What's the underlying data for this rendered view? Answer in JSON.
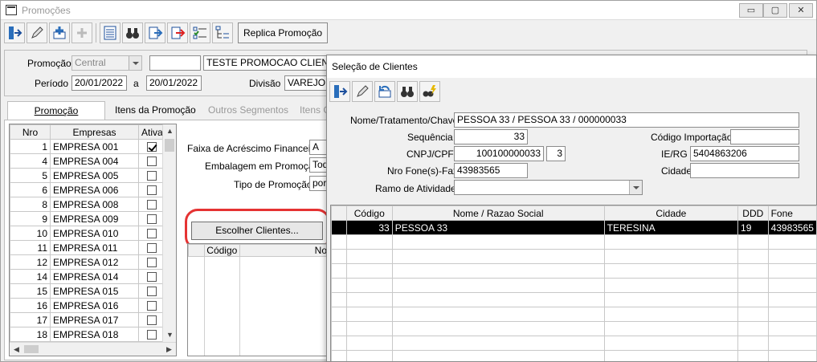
{
  "main_window": {
    "title": "Promoções",
    "controls": {
      "minimize": "▭",
      "restore": "▢",
      "close": "✕"
    },
    "toolbar": {
      "icons": [
        "exit-icon",
        "edit-pencil-icon",
        "add-record-icon",
        "plus-disabled-icon",
        "grid-list-icon",
        "binoculars-search-icon",
        "import-arrow-icon",
        "export-red-arrow-icon",
        "checklist-icon",
        "tree-list-icon"
      ],
      "replica_label": "Replica Promoção"
    },
    "form": {
      "promocao_label": "Promoção",
      "promocao_combo": "Central",
      "promocao_code": "",
      "promocao_desc": "TESTE PROMOCAO CLIENTE",
      "periodo_label": "Período",
      "periodo_inicio": "20/01/2022",
      "periodo_a": "a",
      "periodo_fim": "20/01/2022",
      "divisao_label": "Divisão",
      "divisao_value": "VAREJO"
    },
    "tabs": [
      {
        "label": "Promoção"
      },
      {
        "label": "Itens da Promoção"
      },
      {
        "label": "Outros Segmentos"
      },
      {
        "label": "Itens G"
      }
    ],
    "empresas_grid": {
      "headers": [
        "Nro",
        "Empresas",
        "Ativa"
      ],
      "rows": [
        {
          "nro": "1",
          "empresa": "EMPRESA 001",
          "ativa": true
        },
        {
          "nro": "4",
          "empresa": "EMPRESA 004",
          "ativa": false
        },
        {
          "nro": "5",
          "empresa": "EMPRESA 005",
          "ativa": false
        },
        {
          "nro": "6",
          "empresa": "EMPRESA 006",
          "ativa": false
        },
        {
          "nro": "8",
          "empresa": "EMPRESA 008",
          "ativa": false
        },
        {
          "nro": "9",
          "empresa": "EMPRESA 009",
          "ativa": false
        },
        {
          "nro": "10",
          "empresa": "EMPRESA 010",
          "ativa": false
        },
        {
          "nro": "11",
          "empresa": "EMPRESA 011",
          "ativa": false
        },
        {
          "nro": "12",
          "empresa": "EMPRESA 012",
          "ativa": false
        },
        {
          "nro": "14",
          "empresa": "EMPRESA 014",
          "ativa": false
        },
        {
          "nro": "15",
          "empresa": "EMPRESA 015",
          "ativa": false
        },
        {
          "nro": "16",
          "empresa": "EMPRESA 016",
          "ativa": false
        },
        {
          "nro": "17",
          "empresa": "EMPRESA 017",
          "ativa": false
        },
        {
          "nro": "18",
          "empresa": "EMPRESA 018",
          "ativa": false
        }
      ]
    },
    "fields": {
      "faixa_label": "Faixa de Acréscimo Financeiro",
      "faixa_value": "A",
      "embalagem_label": "Embalagem em Promoção",
      "embalagem_value": "Tod",
      "tipo_label": "Tipo de Promoção",
      "tipo_value": "por"
    },
    "escolher_clientes_label": "Escolher Clientes...",
    "clientes_grid_headers": [
      "Código",
      "No"
    ]
  },
  "dialog": {
    "title": "Seleção de Clientes",
    "toolbar_icons": [
      "exit-icon",
      "edit-pencil-icon",
      "undo-record-icon",
      "binoculars-search-icon",
      "binoculars-flash-icon"
    ],
    "nome_label": "Nome/Tratamento/Chave",
    "nome_value": "PESSOA 33 / PESSOA 33 / 000000033",
    "sequencia_label": "Sequência",
    "sequencia_value": "33",
    "codigo_importacao_label": "Código Importação",
    "codigo_importacao_value": "",
    "cnpj_label": "CNPJ/CPF",
    "cnpj_value": "100100000033",
    "cnpj_digit": "3",
    "ie_label": "IE/RG",
    "ie_value": "5404863206",
    "fone_label": "Nro Fone(s)-Fax",
    "fone_value": "43983565",
    "cidade_label": "Cidade",
    "cidade_value": "",
    "ramo_label": "Ramo de Atividade",
    "ramo_value": "",
    "grid": {
      "headers": [
        "",
        "Código",
        "Nome / Razao Social",
        "Cidade",
        "DDD",
        "Fone"
      ],
      "rows": [
        {
          "codigo": "33",
          "nome": "PESSOA 33",
          "cidade": "TERESINA",
          "ddd": "19",
          "fone": "43983565"
        }
      ]
    }
  }
}
